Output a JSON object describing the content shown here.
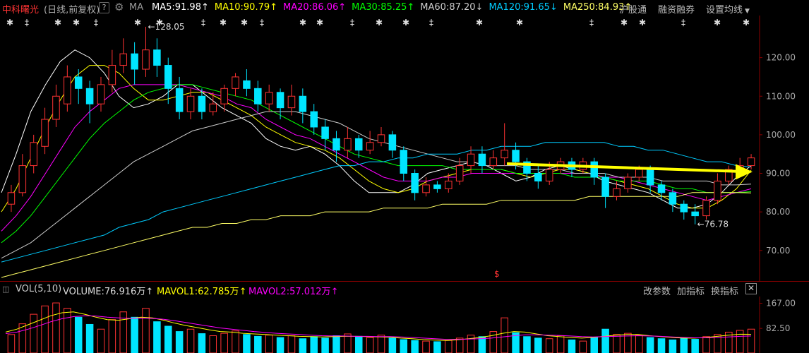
{
  "header": {
    "stock_name": "中科曙光",
    "period": "(日线,前复权)",
    "help": "?",
    "ma_label": "MA",
    "ma_items": [
      {
        "label": "MA5:91.98",
        "arrow": "↑",
        "color": "#ffffff"
      },
      {
        "label": "MA10:90.79",
        "arrow": "↑",
        "color": "#ffff00"
      },
      {
        "label": "MA20:86.06",
        "arrow": "↑",
        "color": "#ff00ff"
      },
      {
        "label": "MA30:85.25",
        "arrow": "↑",
        "color": "#00ff00"
      },
      {
        "label": "MA60:87.20",
        "arrow": "↓",
        "color": "#cccccc"
      },
      {
        "label": "MA120:91.65",
        "arrow": "↓",
        "color": "#00ccff"
      },
      {
        "label": "MA250:84.93",
        "arrow": "↑",
        "color": "#ffff66"
      }
    ],
    "menu": [
      "沪股通",
      "融资融券",
      "设置均线"
    ]
  },
  "volume_header": {
    "title": "VOL(5,10)",
    "volume": "VOLUME:76.916万",
    "volume_arrow": "↑",
    "mavol1": "MAVOL1:62.785万",
    "mavol1_arrow": "↑",
    "mavol2": "MAVOL2:57.012万",
    "mavol2_arrow": "↑",
    "menu": [
      "改参数",
      "加指标",
      "换指标"
    ],
    "close": "✕"
  },
  "colors": {
    "up": "#ff3333",
    "down": "#00e5ff",
    "axis": "#8b0000",
    "arrow": "#ffff00"
  },
  "chart_data": {
    "type": "candlestick",
    "price_axis": {
      "ticks": [
        "120.00",
        "110.00",
        "100.00",
        "90.00",
        "80.00",
        "70.00"
      ],
      "ylim": [
        63,
        130
      ]
    },
    "annotations": {
      "high": "128.05",
      "low": "76.78",
      "marker": "$"
    },
    "ma_series": [
      {
        "name": "MA5",
        "color": "#ffffff",
        "values": [
          85,
          95,
          106,
          113,
          119,
          122,
          120,
          116,
          110,
          107,
          108,
          110,
          113,
          113,
          110,
          107,
          105,
          103,
          99,
          97,
          96,
          97,
          95,
          92,
          88,
          85,
          85,
          85,
          87,
          90,
          91,
          92,
          93,
          92,
          90,
          88,
          89,
          91,
          92,
          91,
          90,
          88,
          87,
          86,
          85,
          83,
          81,
          81,
          82,
          85,
          89,
          92
        ]
      },
      {
        "name": "MA10",
        "color": "#ffff00",
        "values": [
          80,
          86,
          94,
          102,
          109,
          115,
          118,
          118,
          116,
          112,
          109,
          109,
          110,
          111,
          111,
          109,
          107,
          105,
          102,
          100,
          98,
          97,
          96,
          94,
          91,
          88,
          86,
          85,
          86,
          88,
          89,
          90,
          91,
          91,
          91,
          90,
          89,
          90,
          91,
          91,
          90,
          89,
          88,
          87,
          86,
          84,
          82,
          81,
          81,
          83,
          86,
          90.8
        ]
      },
      {
        "name": "MA20",
        "color": "#ff00ff",
        "values": [
          75,
          79,
          84,
          90,
          96,
          102,
          106,
          109,
          112,
          113,
          113,
          113,
          113,
          112,
          111,
          110,
          108,
          107,
          104,
          102,
          100,
          99,
          97,
          95,
          93,
          91,
          89,
          88,
          88,
          88,
          89,
          89,
          90,
          90,
          90,
          90,
          90,
          90,
          90,
          90,
          90,
          89,
          89,
          88,
          87,
          86,
          85,
          84,
          83,
          84,
          85,
          86
        ]
      },
      {
        "name": "MA30",
        "color": "#00ff00",
        "values": [
          72,
          75,
          79,
          84,
          89,
          94,
          99,
          103,
          106,
          109,
          111,
          112,
          113,
          113,
          112,
          111,
          110,
          109,
          107,
          105,
          103,
          101,
          99,
          97,
          95,
          94,
          93,
          92,
          92,
          92,
          92,
          91,
          91,
          91,
          91,
          90,
          90,
          90,
          90,
          89,
          89,
          89,
          88,
          88,
          88,
          87,
          86,
          86,
          85,
          85,
          85,
          85.25
        ]
      },
      {
        "name": "MA60",
        "color": "#cccccc",
        "values": [
          68,
          70,
          72,
          75,
          78,
          81,
          84,
          87,
          90,
          93,
          95,
          97,
          99,
          101,
          102,
          103,
          104,
          105,
          106,
          106,
          106,
          105,
          104,
          103,
          101,
          99,
          98,
          97,
          96,
          95,
          94,
          93,
          93,
          92,
          92,
          92,
          91,
          91,
          91,
          90,
          90,
          90,
          89,
          89,
          89,
          88,
          88,
          88,
          88,
          87,
          87,
          87.2
        ]
      },
      {
        "name": "MA120",
        "color": "#00ccff",
        "values": [
          67,
          68,
          69,
          70,
          71,
          72,
          73,
          74,
          76,
          77,
          78,
          80,
          81,
          82,
          83,
          84,
          85,
          86,
          87,
          88,
          89,
          90,
          91,
          92,
          92,
          93,
          93,
          94,
          94,
          95,
          95,
          95,
          96,
          96,
          97,
          97,
          97,
          98,
          98,
          98,
          98,
          98,
          97,
          97,
          96,
          96,
          95,
          94,
          93,
          93,
          92,
          91.65
        ]
      },
      {
        "name": "MA250",
        "color": "#ffff66",
        "values": [
          63,
          64,
          65,
          66,
          67,
          68,
          69,
          70,
          71,
          72,
          73,
          74,
          75,
          76,
          76,
          77,
          77,
          78,
          78,
          79,
          79,
          79,
          80,
          80,
          80,
          80,
          81,
          81,
          81,
          81,
          82,
          82,
          82,
          82,
          83,
          83,
          83,
          83,
          83,
          83,
          84,
          84,
          84,
          84,
          84,
          84,
          84,
          85,
          85,
          85,
          85,
          84.93
        ]
      }
    ],
    "candles": [
      {
        "o": 82,
        "c": 85,
        "h": 87,
        "l": 80
      },
      {
        "o": 85,
        "c": 92,
        "h": 95,
        "l": 84
      },
      {
        "o": 92,
        "c": 98,
        "h": 100,
        "l": 90
      },
      {
        "o": 97,
        "c": 104,
        "h": 107,
        "l": 95
      },
      {
        "o": 104,
        "c": 110,
        "h": 113,
        "l": 102
      },
      {
        "o": 108,
        "c": 115,
        "h": 118,
        "l": 106
      },
      {
        "o": 115,
        "c": 112,
        "h": 117,
        "l": 108
      },
      {
        "o": 112,
        "c": 108,
        "h": 114,
        "l": 103
      },
      {
        "o": 108,
        "c": 113,
        "h": 115,
        "l": 106
      },
      {
        "o": 113,
        "c": 118,
        "h": 122,
        "l": 111
      },
      {
        "o": 118,
        "c": 121,
        "h": 125,
        "l": 116
      },
      {
        "o": 121,
        "c": 117,
        "h": 124,
        "l": 113
      },
      {
        "o": 117,
        "c": 122,
        "h": 128,
        "l": 115
      },
      {
        "o": 122,
        "c": 118,
        "h": 125,
        "l": 115
      },
      {
        "o": 118,
        "c": 112,
        "h": 120,
        "l": 108
      },
      {
        "o": 112,
        "c": 106,
        "h": 115,
        "l": 104
      },
      {
        "o": 106,
        "c": 110,
        "h": 112,
        "l": 104
      },
      {
        "o": 110,
        "c": 106,
        "h": 112,
        "l": 104
      },
      {
        "o": 106,
        "c": 108,
        "h": 111,
        "l": 105
      },
      {
        "o": 108,
        "c": 112,
        "h": 113,
        "l": 106
      },
      {
        "o": 112,
        "c": 115,
        "h": 116,
        "l": 110
      },
      {
        "o": 114,
        "c": 112,
        "h": 117,
        "l": 110
      },
      {
        "o": 112,
        "c": 108,
        "h": 114,
        "l": 106
      },
      {
        "o": 108,
        "c": 111,
        "h": 113,
        "l": 106
      },
      {
        "o": 111,
        "c": 107,
        "h": 112,
        "l": 104
      },
      {
        "o": 107,
        "c": 110,
        "h": 113,
        "l": 105
      },
      {
        "o": 110,
        "c": 106,
        "h": 112,
        "l": 103
      },
      {
        "o": 106,
        "c": 102,
        "h": 108,
        "l": 100
      },
      {
        "o": 102,
        "c": 99,
        "h": 104,
        "l": 96
      },
      {
        "o": 99,
        "c": 96,
        "h": 101,
        "l": 93
      },
      {
        "o": 96,
        "c": 99,
        "h": 102,
        "l": 94
      },
      {
        "o": 99,
        "c": 96,
        "h": 100,
        "l": 94
      },
      {
        "o": 96,
        "c": 98,
        "h": 101,
        "l": 95
      },
      {
        "o": 98,
        "c": 100,
        "h": 102,
        "l": 97
      },
      {
        "o": 100,
        "c": 96,
        "h": 101,
        "l": 94
      },
      {
        "o": 96,
        "c": 90,
        "h": 97,
        "l": 88
      },
      {
        "o": 90,
        "c": 85,
        "h": 91,
        "l": 83
      },
      {
        "o": 85,
        "c": 87,
        "h": 89,
        "l": 84
      },
      {
        "o": 87,
        "c": 86,
        "h": 88,
        "l": 85
      },
      {
        "o": 86,
        "c": 88,
        "h": 90,
        "l": 85
      },
      {
        "o": 88,
        "c": 92,
        "h": 94,
        "l": 87
      },
      {
        "o": 92,
        "c": 95,
        "h": 97,
        "l": 90
      },
      {
        "o": 95,
        "c": 92,
        "h": 97,
        "l": 90
      },
      {
        "o": 92,
        "c": 94,
        "h": 96,
        "l": 91
      },
      {
        "o": 94,
        "c": 96,
        "h": 103,
        "l": 92
      },
      {
        "o": 96,
        "c": 93,
        "h": 98,
        "l": 91
      },
      {
        "o": 93,
        "c": 90,
        "h": 94,
        "l": 88
      },
      {
        "o": 90,
        "c": 88,
        "h": 92,
        "l": 86
      },
      {
        "o": 88,
        "c": 91,
        "h": 93,
        "l": 87
      },
      {
        "o": 91,
        "c": 93,
        "h": 94,
        "l": 90
      },
      {
        "o": 93,
        "c": 91,
        "h": 94,
        "l": 89
      },
      {
        "o": 91,
        "c": 93,
        "h": 94,
        "l": 90
      },
      {
        "o": 93,
        "c": 89,
        "h": 94,
        "l": 87
      },
      {
        "o": 89,
        "c": 84,
        "h": 90,
        "l": 81
      },
      {
        "o": 84,
        "c": 86,
        "h": 88,
        "l": 83
      },
      {
        "o": 86,
        "c": 89,
        "h": 90,
        "l": 85
      },
      {
        "o": 89,
        "c": 91,
        "h": 92,
        "l": 88
      },
      {
        "o": 91,
        "c": 87,
        "h": 92,
        "l": 85
      },
      {
        "o": 87,
        "c": 85,
        "h": 88,
        "l": 83
      },
      {
        "o": 85,
        "c": 82,
        "h": 86,
        "l": 80
      },
      {
        "o": 82,
        "c": 80,
        "h": 83,
        "l": 78
      },
      {
        "o": 80,
        "c": 79,
        "h": 82,
        "l": 76.78
      },
      {
        "o": 79,
        "c": 83,
        "h": 84,
        "l": 78
      },
      {
        "o": 83,
        "c": 88,
        "h": 90,
        "l": 82
      },
      {
        "o": 88,
        "c": 91,
        "h": 92,
        "l": 87
      },
      {
        "o": 91,
        "c": 92,
        "h": 94,
        "l": 90
      },
      {
        "o": 92,
        "c": 94,
        "h": 95,
        "l": 91
      }
    ],
    "volume_axis": {
      "ticks": [
        "167.00",
        "82.50"
      ],
      "ylim": [
        0,
        180
      ]
    },
    "volume": [
      62,
      98,
      130,
      158,
      168,
      150,
      120,
      96,
      80,
      112,
      138,
      120,
      150,
      105,
      90,
      72,
      80,
      65,
      58,
      66,
      74,
      62,
      56,
      60,
      52,
      58,
      48,
      55,
      50,
      58,
      64,
      56,
      52,
      60,
      50,
      45,
      42,
      40,
      38,
      42,
      50,
      60,
      55,
      72,
      118,
      68,
      55,
      50,
      48,
      58,
      44,
      40,
      52,
      80,
      62,
      66,
      60,
      52,
      48,
      44,
      50,
      46,
      55,
      62,
      70,
      76,
      80
    ],
    "mavol1": [
      70,
      80,
      95,
      110,
      125,
      135,
      138,
      130,
      120,
      112,
      110,
      115,
      120,
      118,
      110,
      100,
      92,
      85,
      78,
      72,
      70,
      66,
      64,
      62,
      60,
      58,
      56,
      55,
      54,
      55,
      56,
      56,
      55,
      54,
      53,
      50,
      48,
      45,
      43,
      42,
      44,
      48,
      52,
      58,
      66,
      72,
      70,
      64,
      58,
      55,
      52,
      50,
      52,
      56,
      60,
      62,
      62,
      58,
      55,
      52,
      50,
      50,
      52,
      56,
      60,
      63,
      62.785
    ],
    "mavol2": [
      65,
      70,
      80,
      92,
      105,
      115,
      122,
      125,
      124,
      120,
      118,
      116,
      117,
      116,
      113,
      108,
      102,
      96,
      90,
      84,
      80,
      76,
      72,
      69,
      66,
      64,
      62,
      60,
      58,
      57,
      57,
      56,
      56,
      55,
      55,
      54,
      52,
      50,
      48,
      46,
      46,
      47,
      48,
      50,
      54,
      58,
      61,
      61,
      60,
      59,
      57,
      55,
      54,
      55,
      56,
      57,
      58,
      57,
      56,
      54,
      52,
      51,
      51,
      52,
      54,
      56,
      57.012
    ]
  }
}
